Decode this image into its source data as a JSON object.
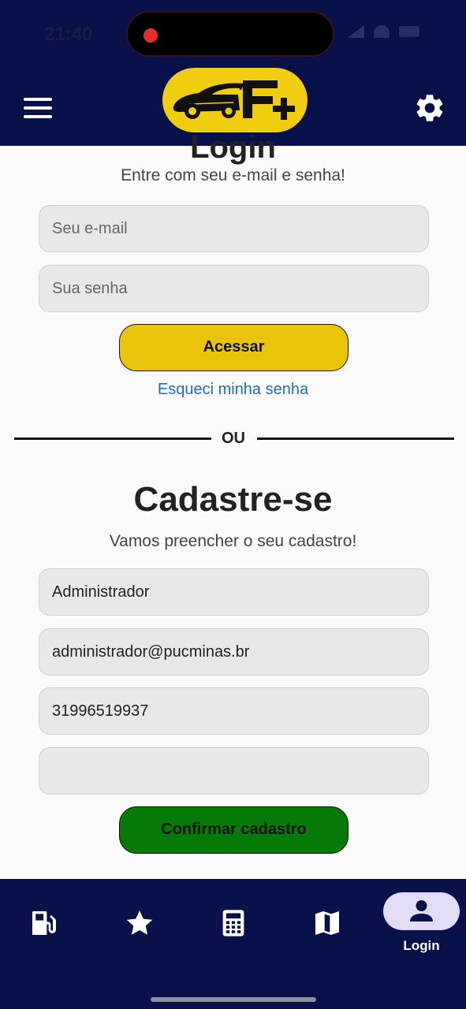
{
  "status_bar": {
    "time": "21:40"
  },
  "header": {
    "logo_text": "F+"
  },
  "login": {
    "title": "Login",
    "subtitle": "Entre com seu e-mail e senha!",
    "email_placeholder": "Seu e-mail",
    "password_placeholder": "Sua senha",
    "submit_label": "Acessar",
    "forgot_label": "Esqueci minha senha"
  },
  "divider_label": "OU",
  "register": {
    "title": "Cadastre-se",
    "subtitle": "Vamos preencher o seu cadastro!",
    "name_value": "Administrador",
    "email_value": "administrador@pucminas.br",
    "phone_value": "31996519937",
    "extra_value": "",
    "submit_label": "Confirmar cadastro"
  },
  "bottom_nav": {
    "items": [
      {
        "icon": "fuel-pump-icon"
      },
      {
        "icon": "star-icon"
      },
      {
        "icon": "calculator-icon"
      },
      {
        "icon": "map-icon"
      },
      {
        "icon": "person-icon",
        "label": "Login",
        "active": true
      }
    ]
  },
  "colors": {
    "navy": "#08114a",
    "yellow": "#e9c40a",
    "green": "#067a06",
    "link_blue": "#1a6fc4",
    "active_pill": "#e3dcf6"
  }
}
